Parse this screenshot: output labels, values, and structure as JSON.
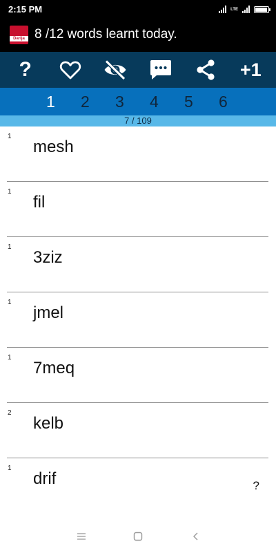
{
  "status_bar": {
    "time": "2:15 PM",
    "network": "LTE"
  },
  "app_bar": {
    "logo_text": "Darija",
    "title": "8 /12 words learnt today."
  },
  "toolbar": {
    "help_label": "?",
    "items": [
      "help-icon",
      "heart-icon",
      "eye-off-icon",
      "comment-icon",
      "share-icon",
      "plus-one"
    ],
    "plus_label": "+1"
  },
  "tabs": [
    "1",
    "2",
    "3",
    "4",
    "5",
    "6"
  ],
  "active_tab": "1",
  "progress": {
    "text": "7 / 109",
    "current": 7,
    "total": 109
  },
  "words": [
    {
      "count": "1",
      "word": "mesh"
    },
    {
      "count": "1",
      "word": "fil"
    },
    {
      "count": "1",
      "word": "3ziz"
    },
    {
      "count": "1",
      "word": "jmel"
    },
    {
      "count": "1",
      "word": "7meq"
    },
    {
      "count": "2",
      "word": "kelb"
    },
    {
      "count": "1",
      "word": "drif"
    }
  ],
  "hint_label": "?",
  "colors": {
    "toolbar_bg": "#073a5b",
    "tabs_bg": "#0770bc",
    "progress_bg": "#58b8e8",
    "logo_red": "#c8102e"
  }
}
